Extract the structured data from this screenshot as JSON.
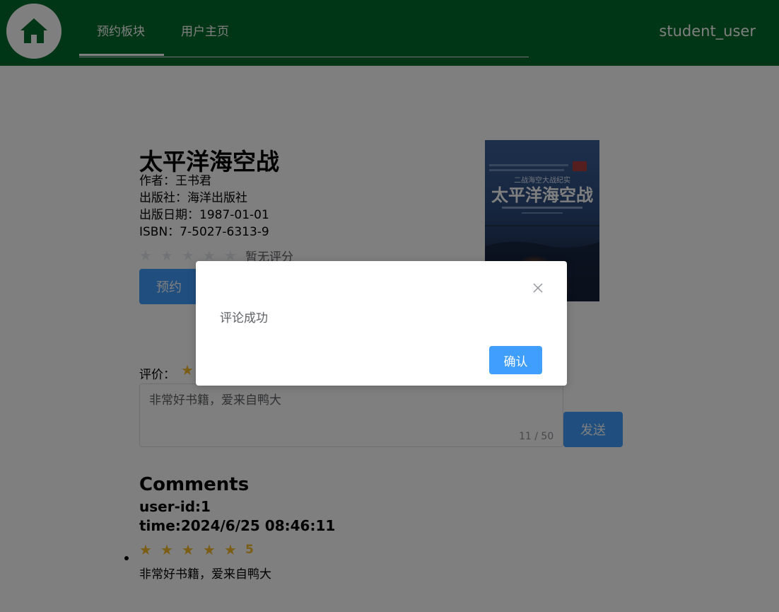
{
  "header": {
    "nav": [
      {
        "label": "预约板块",
        "active": true
      },
      {
        "label": "用户主页",
        "active": false
      }
    ],
    "username": "student_user",
    "home_icon": "home-icon"
  },
  "book": {
    "title": "太平洋海空战",
    "author": "作者：王书君",
    "publisher": "出版社：海洋出版社",
    "publish_date": "出版日期：1987-01-01",
    "isbn": "ISBN：7-5027-6313-9",
    "rating": 0,
    "rating_text": "暂无评分",
    "reserve_label": "预约",
    "cover": {
      "top_text": "二战海空大战纪实",
      "title_text": "太平洋海空战"
    }
  },
  "review": {
    "label": "评价：",
    "rating": 1,
    "content": "非常好书籍，爱来自鸭大",
    "count": "11 / 50",
    "send_label": "发送"
  },
  "comments": {
    "title": "Comments",
    "items": [
      {
        "user": "user-id:1",
        "time": "time:2024/6/25 08:46:11",
        "rating": 5,
        "score": "5",
        "text": "非常好书籍，爱来自鸭大"
      }
    ]
  },
  "dialog": {
    "message": "评论成功",
    "ok_label": "确认",
    "close_icon": "close-icon"
  },
  "colors": {
    "header_bg": "#006d2b",
    "primary": "#409eff",
    "star": "#f7ba2a"
  }
}
